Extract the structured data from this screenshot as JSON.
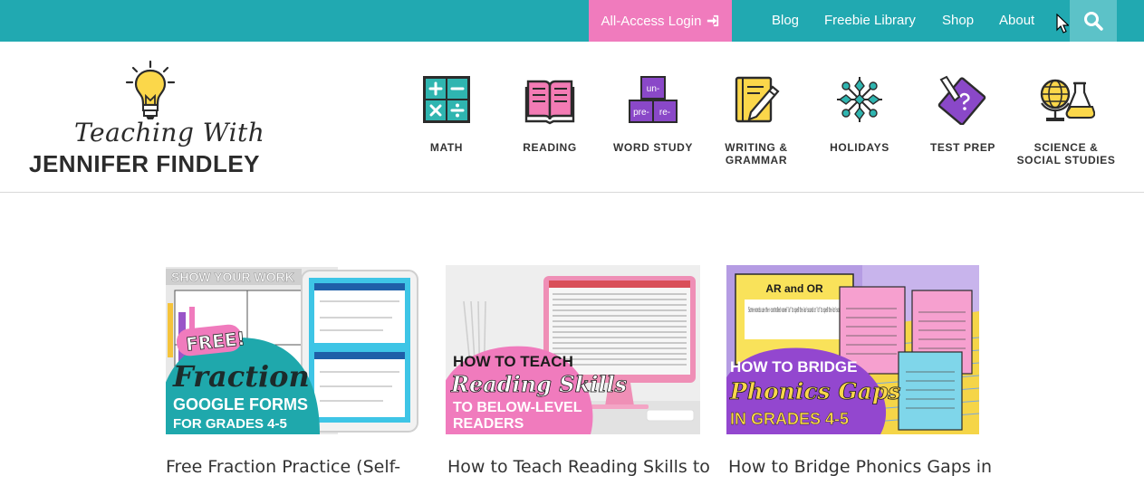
{
  "topbar": {
    "login_label": "All-Access Login",
    "nav": [
      "Blog",
      "Freebie Library",
      "Shop",
      "About"
    ],
    "colors": {
      "bar": "#21a9b1",
      "login": "#f07bbd",
      "search": "#5cc2c8"
    }
  },
  "logo": {
    "script_text": "Teaching With",
    "name_text": "JENNIFER FINDLEY"
  },
  "categories": [
    {
      "label": "MATH",
      "icon": "math-icon"
    },
    {
      "label": "READING",
      "icon": "book-icon"
    },
    {
      "label": "WORD STUDY",
      "icon": "word-study-icon",
      "tiles": [
        "un-",
        "pre-",
        "re-"
      ]
    },
    {
      "label": "WRITING &",
      "label2": "GRAMMAR",
      "icon": "notebook-pencil-icon"
    },
    {
      "label": "HOLIDAYS",
      "icon": "snowflake-icon"
    },
    {
      "label": "TEST PREP",
      "icon": "test-prep-icon"
    },
    {
      "label": "SCIENCE &",
      "label2": "SOCIAL STUDIES",
      "icon": "globe-flask-icon"
    }
  ],
  "posts": [
    {
      "title": "Free Fraction Practice (Self-",
      "thumb": {
        "header": "SHOW YOUR WORK",
        "badge": "FREE!",
        "script": "Fraction",
        "line1": "GOOGLE FORMS",
        "line2": "FOR GRADES 4-5"
      }
    },
    {
      "title": "How to Teach Reading Skills to",
      "thumb": {
        "line1": "HOW TO TEACH",
        "script": "Reading Skills",
        "line2": "TO BELOW-LEVEL",
        "line3": "READERS"
      }
    },
    {
      "title": "How to Bridge Phonics Gaps in",
      "thumb": {
        "card_title": "AR and OR",
        "card_text": "Some words use the r-controlled vowel \"ar\" to spell the /ar/ sound or \"or\" to spell the /or/ sound",
        "line1": "HOW TO BRIDGE",
        "script": "Phonics Gaps",
        "line2": "IN GRADES 4-5"
      }
    }
  ]
}
